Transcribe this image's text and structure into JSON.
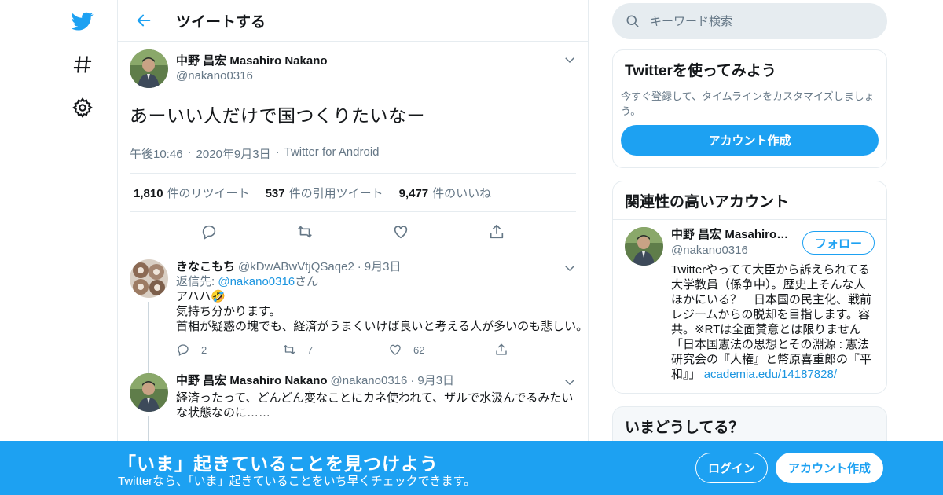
{
  "colors": {
    "accent": "#1da1f2",
    "text": "#14171a",
    "muted": "#657786",
    "border": "#e6ecf0"
  },
  "nav": {
    "icons": [
      "twitter-logo-icon",
      "hashtag-icon",
      "gear-icon"
    ]
  },
  "header": {
    "title": "ツイートする"
  },
  "tweet": {
    "name": "中野 昌宏 Masahiro Nakano",
    "handle": "@nakano0316",
    "text": "あーいい人だけで国つくりたいなー",
    "time": "午後10:46",
    "date": "2020年9月3日",
    "source": "Twitter for Android",
    "retweets": "1,810",
    "retweets_label": "件のリツイート",
    "quotes": "537",
    "quotes_label": "件の引用ツイート",
    "likes": "9,477",
    "likes_label": "件のいいね"
  },
  "replies": [
    {
      "name": "きなこもち",
      "handle": "@kDwABwVtjQSaqe2",
      "date": "9月3日",
      "replying_prefix": "返信先: ",
      "replying_to": "@nakano0316",
      "replying_suffix": "さん",
      "text": "アハハ🤣\n気持ち分かります。\n首相が疑惑の塊でも、経済がうまくいけば良いと考える人が多いのも悲しい。",
      "reply_count": "2",
      "retweet_count": "7",
      "like_count": "62"
    },
    {
      "name": "中野 昌宏 Masahiro Nakano",
      "handle": "@nakano0316",
      "date": "9月3日",
      "text": "経済ったって、どんどん変なことにカネ使われて、ザルで水汲んでるみたいな状態なのに……"
    }
  ],
  "search": {
    "placeholder": "キーワード検索"
  },
  "signup_card": {
    "title": "Twitterを使ってみよう",
    "desc": "今すぐ登録して、タイムラインをカスタマイズしましょう。",
    "button": "アカウント作成"
  },
  "related": {
    "title": "関連性の高いアカウント",
    "name": "中野 昌宏 Masahiro Nakano",
    "handle": "@nakano0316",
    "follow": "フォロー",
    "bio": "Twitterやってて大臣から訴えられてる大学教員（係争中）。歴史上そんな人ほかにいる？　日本国の民主化、戦前レジームからの脱却を目指します。容共。※RTは全面賛意とは限りません「日本国憲法の思想とその淵源 : 憲法研究会の『人権』と幣原喜重郎の『平和』」",
    "link": "academia.edu/14187828/"
  },
  "trends": {
    "title": "いまどうしてる？"
  },
  "banner": {
    "title": "「いま」起きていることを見つけよう",
    "subtitle": "Twitterなら、「いま」起きていることをいち早くチェックできます。",
    "login": "ログイン",
    "signup": "アカウント作成"
  }
}
